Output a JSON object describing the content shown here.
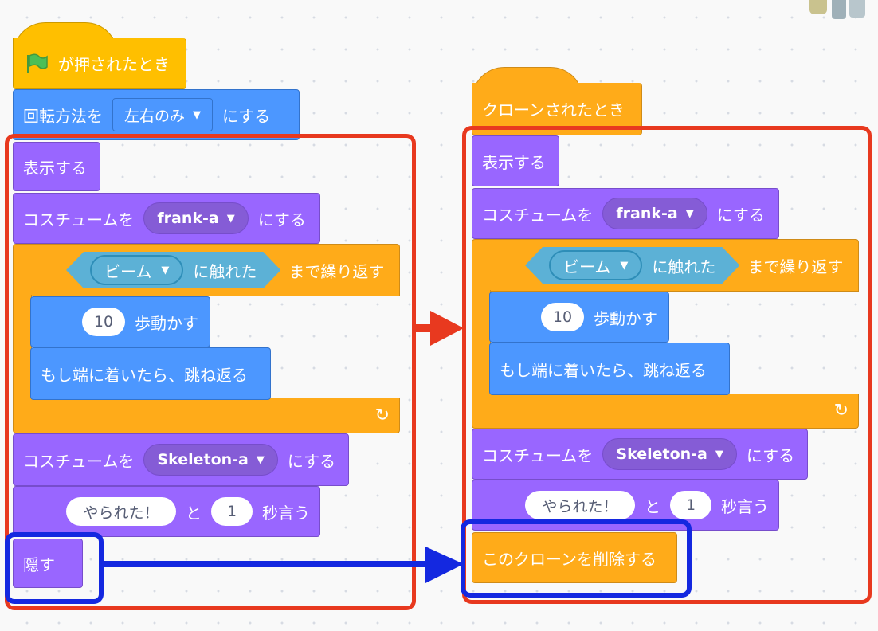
{
  "left_script": {
    "hat_label": "が押されたとき",
    "rotation": {
      "label": "回転方法を",
      "value": "左右のみ",
      "suffix": "にする"
    },
    "show": "表示する",
    "costume1": {
      "label": "コスチュームを",
      "value": "frank-a",
      "suffix": "にする"
    },
    "repeat_until": {
      "sensor_value": "ビーム",
      "sensor_text": "に触れた",
      "suffix": "まで繰り返す"
    },
    "move": {
      "value": "10",
      "label": "歩動かす"
    },
    "bounce": "もし端に着いたら、跳ね返る",
    "costume2": {
      "label": "コスチュームを",
      "value": "Skeleton-a",
      "suffix": "にする"
    },
    "say": {
      "text": "やられた！",
      "and": "と",
      "secs": "1",
      "suffix": "秒言う"
    },
    "hide": "隠す"
  },
  "right_script": {
    "hat_label": "クローンされたとき",
    "show": "表示する",
    "costume1": {
      "label": "コスチュームを",
      "value": "frank-a",
      "suffix": "にする"
    },
    "repeat_until": {
      "sensor_value": "ビーム",
      "sensor_text": "に触れた",
      "suffix": "まで繰り返す"
    },
    "move": {
      "value": "10",
      "label": "歩動かす"
    },
    "bounce": "もし端に着いたら、跳ね返る",
    "costume2": {
      "label": "コスチュームを",
      "value": "Skeleton-a",
      "suffix": "にする"
    },
    "say": {
      "text": "やられた！",
      "and": "と",
      "secs": "1",
      "suffix": "秒言う"
    },
    "delete_clone": "このクローンを削除する"
  },
  "colors": {
    "motion": "#4c97ff",
    "looks": "#9966ff",
    "control": "#ffab19",
    "event": "#ffbf00",
    "sensing": "#5cb1d6",
    "highlight_red": "#e8391f",
    "highlight_blue": "#1428e0"
  },
  "icons": [
    "green-flag-icon",
    "dropdown-caret-icon",
    "loop-arrow-icon",
    "red-arrow-icon",
    "blue-arrow-icon"
  ]
}
